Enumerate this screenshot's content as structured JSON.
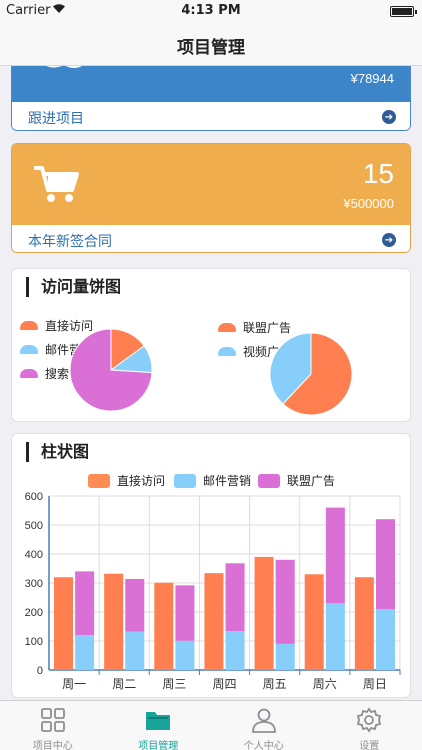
{
  "status_bar": {
    "carrier": "Carrier",
    "time": "4:13 PM"
  },
  "nav": {
    "title": "项目管理"
  },
  "cards": {
    "follow": {
      "value": "¥78944",
      "label": "跟进项目"
    },
    "contracts": {
      "count": "15",
      "value": "¥500000",
      "label": "本年新签合同"
    }
  },
  "pie_section": {
    "title": "访问量饼图",
    "legend_left": [
      "直接访问",
      "邮件营销",
      "搜索引擎"
    ],
    "legend_right": [
      "联盟广告",
      "视频广告"
    ]
  },
  "bar_section": {
    "title": "柱状图",
    "legend": [
      "直接访问",
      "邮件营销",
      "联盟广告"
    ]
  },
  "colors": {
    "direct": "#ff8c55",
    "email": "#87cefa",
    "search": "#da70d6",
    "alliance": "#ff7f50",
    "video": "#87cefa",
    "accent": "#18a39b"
  },
  "chart_data": [
    {
      "type": "pie",
      "series": [
        {
          "name": "直接访问",
          "value": 15,
          "color": "#ff7f50"
        },
        {
          "name": "邮件营销",
          "value": 11,
          "color": "#87cefa"
        },
        {
          "name": "搜索引擎",
          "value": 74,
          "color": "#da70d6"
        }
      ]
    },
    {
      "type": "pie",
      "series": [
        {
          "name": "联盟广告",
          "value": 62,
          "color": "#ff7f50"
        },
        {
          "name": "视频广告",
          "value": 38,
          "color": "#87cefa"
        }
      ]
    },
    {
      "type": "bar",
      "categories": [
        "周一",
        "周二",
        "周三",
        "周四",
        "周五",
        "周六",
        "周日"
      ],
      "ylim": [
        0,
        600
      ],
      "yticks": [
        0,
        100,
        200,
        300,
        400,
        500,
        600
      ],
      "series": [
        {
          "name": "直接访问",
          "color": "#ff7f50",
          "values": [
            320,
            332,
            301,
            334,
            390,
            330,
            320
          ]
        },
        {
          "name": "邮件营销",
          "color": "#87cefa",
          "values": [
            120,
            132,
            101,
            134,
            90,
            230,
            210
          ]
        },
        {
          "name": "联盟广告",
          "color": "#da70d6",
          "values": [
            220,
            182,
            191,
            234,
            290,
            330,
            310
          ]
        }
      ],
      "stacking": "邮件营销 and 联盟广告 stacked"
    }
  ],
  "tabbar": {
    "tabs": [
      {
        "label": "项目中心",
        "icon": "grid-icon"
      },
      {
        "label": "项目管理",
        "icon": "folder-icon"
      },
      {
        "label": "个人中心",
        "icon": "person-icon"
      },
      {
        "label": "设置",
        "icon": "gear-icon"
      }
    ],
    "active_index": 1
  }
}
